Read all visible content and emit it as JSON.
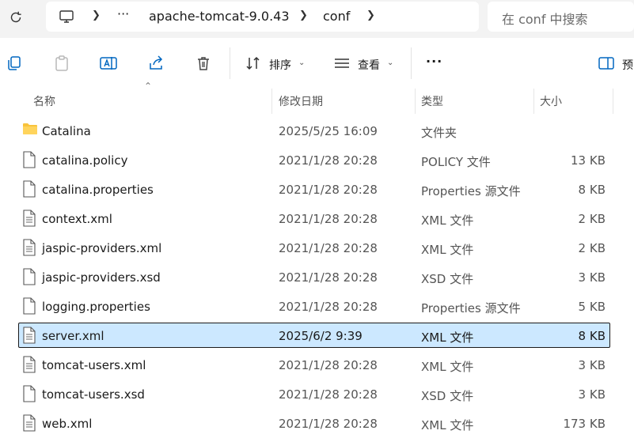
{
  "address_bar": {
    "overflow": "···",
    "crumbs": [
      "apache-tomcat-9.0.43",
      "conf"
    ],
    "search_placeholder": "在 conf 中搜索"
  },
  "toolbar": {
    "sort_label": "排序",
    "view_label": "查看",
    "more_label": "···",
    "preview_label": "预"
  },
  "columns": {
    "name": "名称",
    "date": "修改日期",
    "type": "类型",
    "size": "大小"
  },
  "files": [
    {
      "name": "Catalina",
      "date": "2025/5/25 16:09",
      "type": "文件夹",
      "size": "",
      "kind": "folder",
      "selected": false
    },
    {
      "name": "catalina.policy",
      "date": "2021/1/28 20:28",
      "type": "POLICY 文件",
      "size": "13 KB",
      "kind": "file",
      "selected": false
    },
    {
      "name": "catalina.properties",
      "date": "2021/1/28 20:28",
      "type": "Properties 源文件",
      "size": "8 KB",
      "kind": "file",
      "selected": false
    },
    {
      "name": "context.xml",
      "date": "2021/1/28 20:28",
      "type": "XML 文件",
      "size": "2 KB",
      "kind": "lines",
      "selected": false
    },
    {
      "name": "jaspic-providers.xml",
      "date": "2021/1/28 20:28",
      "type": "XML 文件",
      "size": "2 KB",
      "kind": "lines",
      "selected": false
    },
    {
      "name": "jaspic-providers.xsd",
      "date": "2021/1/28 20:28",
      "type": "XSD 文件",
      "size": "3 KB",
      "kind": "file",
      "selected": false
    },
    {
      "name": "logging.properties",
      "date": "2021/1/28 20:28",
      "type": "Properties 源文件",
      "size": "5 KB",
      "kind": "file",
      "selected": false
    },
    {
      "name": "server.xml",
      "date": "2025/6/2 9:39",
      "type": "XML 文件",
      "size": "8 KB",
      "kind": "lines",
      "selected": true
    },
    {
      "name": "tomcat-users.xml",
      "date": "2021/1/28 20:28",
      "type": "XML 文件",
      "size": "3 KB",
      "kind": "lines",
      "selected": false
    },
    {
      "name": "tomcat-users.xsd",
      "date": "2021/1/28 20:28",
      "type": "XSD 文件",
      "size": "3 KB",
      "kind": "file",
      "selected": false
    },
    {
      "name": "web.xml",
      "date": "2021/1/28 20:28",
      "type": "XML 文件",
      "size": "173 KB",
      "kind": "lines",
      "selected": false
    }
  ],
  "colors": {
    "selection": "#cce8ff",
    "folder": "#f8c33c",
    "accent": "#0067c0"
  }
}
